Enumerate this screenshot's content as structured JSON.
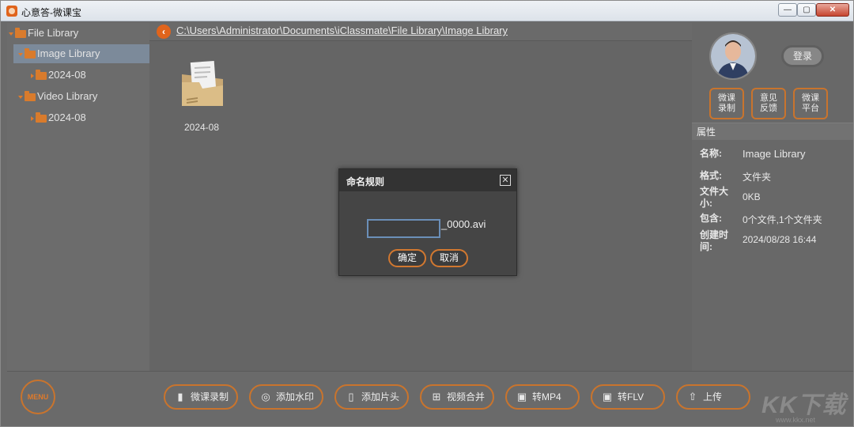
{
  "window": {
    "title": "心意答-微课宝",
    "min": "—",
    "max": "▢",
    "close": "✕"
  },
  "tree": {
    "items": [
      {
        "label": "File Library"
      },
      {
        "label": "Image Library"
      },
      {
        "label": "2024-08"
      },
      {
        "label": "Video Library"
      },
      {
        "label": "2024-08"
      }
    ]
  },
  "path": {
    "text": "C:\\Users\\Administrator\\Documents\\iClassmate\\File Library\\Image Library"
  },
  "main": {
    "files": [
      {
        "label": "2024-08"
      }
    ]
  },
  "right": {
    "login": "登录",
    "buttons": [
      {
        "line1": "微课",
        "line2": "录制"
      },
      {
        "line1": "意见",
        "line2": "反馈"
      },
      {
        "line1": "微课",
        "line2": "平台"
      }
    ],
    "props_title": "属性",
    "props": [
      {
        "key": "名称:",
        "value": "Image Library"
      },
      {
        "key": "格式:",
        "value": "文件夹"
      },
      {
        "key": "文件大小:",
        "value": "0KB"
      },
      {
        "key": "包含:",
        "value": "0个文件,1个文件夹"
      },
      {
        "key": "创建时间:",
        "value": "2024/08/28  16:44"
      }
    ]
  },
  "dialog": {
    "title": "命名规则",
    "input_value": "",
    "suffix": "_0000.avi",
    "ok": "确定",
    "cancel": "取消"
  },
  "toolbar": {
    "menu": "MENU",
    "buttons": [
      {
        "label": "微课录制",
        "icon": "pencil-icon"
      },
      {
        "label": "添加水印",
        "icon": "watermark-icon"
      },
      {
        "label": "添加片头",
        "icon": "title-icon"
      },
      {
        "label": "视频合并",
        "icon": "merge-icon"
      },
      {
        "label": "转MP4",
        "icon": "mp4-icon"
      },
      {
        "label": "转FLV",
        "icon": "flv-icon"
      },
      {
        "label": "上传",
        "icon": "upload-icon"
      }
    ]
  },
  "watermark": {
    "text": "KK下载",
    "url": "www.kkx.net"
  }
}
